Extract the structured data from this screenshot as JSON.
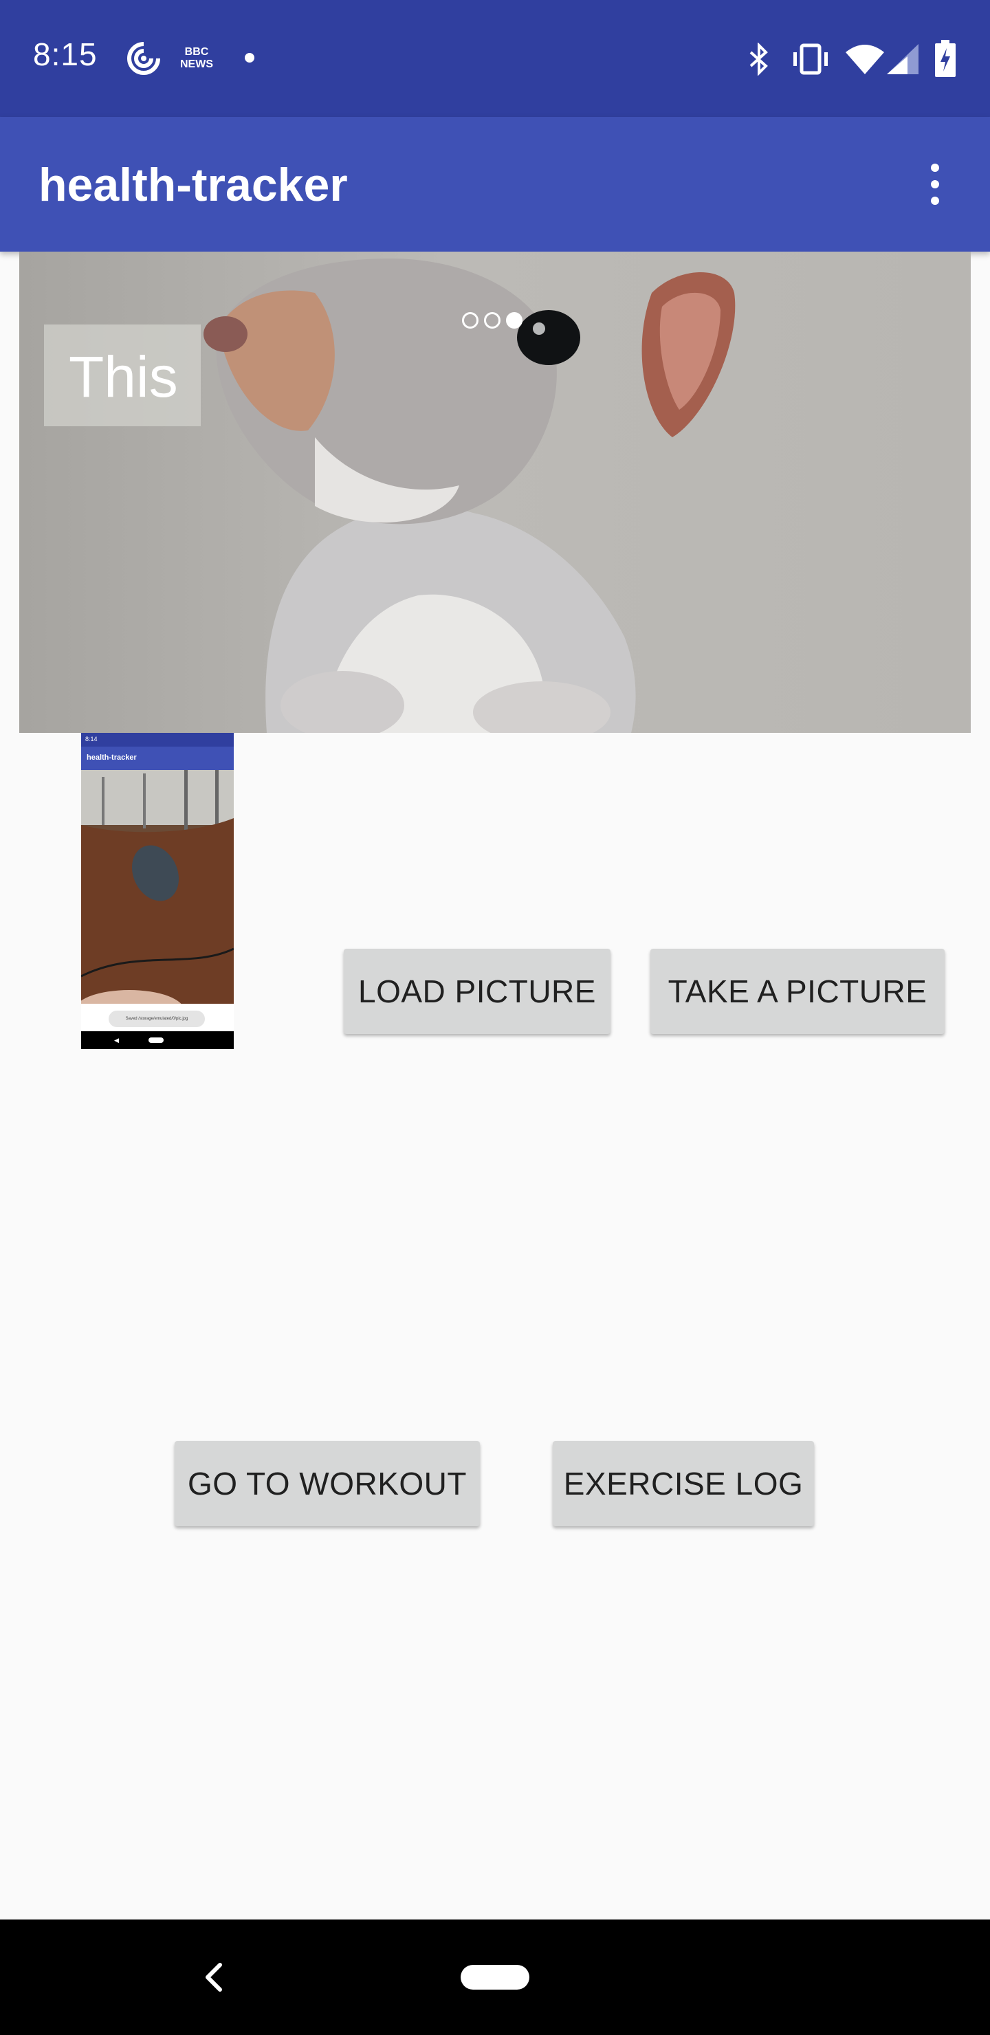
{
  "status_bar": {
    "time": "8:15",
    "icons": [
      "podcast-icon",
      "bbc-news-icon",
      "notification-dot-icon",
      "bluetooth-icon",
      "vibrate-icon",
      "wifi-icon",
      "cell-signal-icon",
      "battery-charging-icon"
    ],
    "news_badge_line1": "BBC",
    "news_badge_line2": "NEWS"
  },
  "app_bar": {
    "title": "health-tracker",
    "menu_icon": "overflow-menu-icon"
  },
  "carousel": {
    "caption": "This",
    "image": "squirrel-photo",
    "page_count": 3,
    "active_page": 3
  },
  "thumbnail": {
    "status_time": "8:14",
    "app_title": "health-tracker",
    "toast_text": "Saved /storage/emulated/0/pic.jpg"
  },
  "buttons": {
    "load_picture": "LOAD PICTURE",
    "take_picture": "TAKE A PICTURE",
    "go_to_workout": "GO TO WORKOUT",
    "exercise_log": "EXERCISE LOG"
  },
  "nav_bar": {
    "back_icon": "back-icon",
    "home_icon": "home-pill-icon"
  },
  "colors": {
    "status_bar": "#303f9f",
    "app_bar": "#3f51b5",
    "background": "#fafafa",
    "button": "#d6d7d7"
  }
}
